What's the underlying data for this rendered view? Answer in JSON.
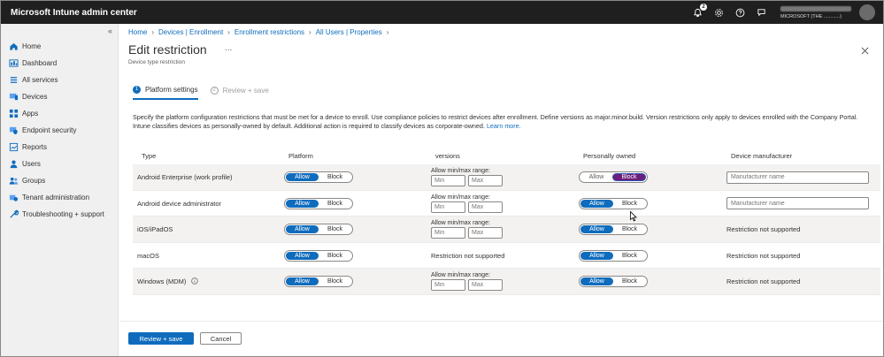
{
  "app": {
    "title": "Microsoft Intune admin center",
    "notification_count": "2",
    "account_tenant": "MICROSOFT (THE ............)"
  },
  "topbar_icons": [
    "bell-icon",
    "gear-icon",
    "help-icon",
    "feedback-icon"
  ],
  "sidebar": {
    "items": [
      {
        "label": "Home",
        "icon": "home-icon"
      },
      {
        "label": "Dashboard",
        "icon": "dashboard-icon"
      },
      {
        "label": "All services",
        "icon": "all-services-icon"
      },
      {
        "label": "Devices",
        "icon": "devices-icon"
      },
      {
        "label": "Apps",
        "icon": "apps-icon"
      },
      {
        "label": "Endpoint security",
        "icon": "endpoint-security-icon"
      },
      {
        "label": "Reports",
        "icon": "reports-icon"
      },
      {
        "label": "Users",
        "icon": "users-icon"
      },
      {
        "label": "Groups",
        "icon": "groups-icon"
      },
      {
        "label": "Tenant administration",
        "icon": "tenant-admin-icon"
      },
      {
        "label": "Troubleshooting + support",
        "icon": "troubleshooting-icon"
      }
    ]
  },
  "breadcrumb": [
    "Home",
    "Devices | Enrollment",
    "Enrollment restrictions",
    "All Users | Properties"
  ],
  "page": {
    "title": "Edit restriction",
    "more": "...",
    "subtitle": "Device type restriction"
  },
  "wizard": {
    "steps": [
      {
        "num": "1",
        "label": "Platform settings"
      },
      {
        "num": "2",
        "label": "Review + save"
      }
    ]
  },
  "description": {
    "text": "Specify the platform configuration restrictions that must be met for a device to enroll. Use compliance policies to restrict devices after enrollment. Define versions as major.minor.build. Version restrictions only apply to devices enrolled with the Company Portal. Intune classifies devices as personally-owned by default. Additional action is required to classify devices as corporate-owned.",
    "link": "Learn more."
  },
  "table": {
    "headers": {
      "type": "Type",
      "platform": "Platform",
      "versions": "versions",
      "personally_owned": "Personally owned",
      "manufacturer": "Device manufacturer"
    },
    "allow_label": "Allow",
    "block_label": "Block",
    "range_label": "Allow min/max range:",
    "min_placeholder": "Min",
    "max_placeholder": "Max",
    "manufacturer_placeholder": "Manufacturer name",
    "not_supported": "Restriction not supported",
    "rows": [
      {
        "type": "Android Enterprise (work profile)",
        "platform": "Allow",
        "versions": "range",
        "personally_owned": "Block",
        "manufacturer": "input"
      },
      {
        "type": "Android device administrator",
        "platform": "Allow",
        "versions": "range",
        "personally_owned": "Allow",
        "manufacturer": "input"
      },
      {
        "type": "iOS/iPadOS",
        "platform": "Allow",
        "versions": "range",
        "personally_owned": "Allow",
        "manufacturer": "Restriction not supported"
      },
      {
        "type": "macOS",
        "platform": "Allow",
        "versions": "Restriction not supported",
        "personally_owned": "Allow",
        "manufacturer": "Restriction not supported"
      },
      {
        "type": "Windows (MDM)",
        "platform": "Allow",
        "versions": "range",
        "personally_owned": "Allow",
        "manufacturer": "Restriction not supported",
        "info_icon": true
      }
    ]
  },
  "footer": {
    "primary": "Review + save",
    "secondary": "Cancel"
  },
  "colors": {
    "accent": "#0f6cbd",
    "topbar": "#1f1f1f",
    "sidebar": "#f0f0f0",
    "block_selected": "#6b1f7a"
  }
}
